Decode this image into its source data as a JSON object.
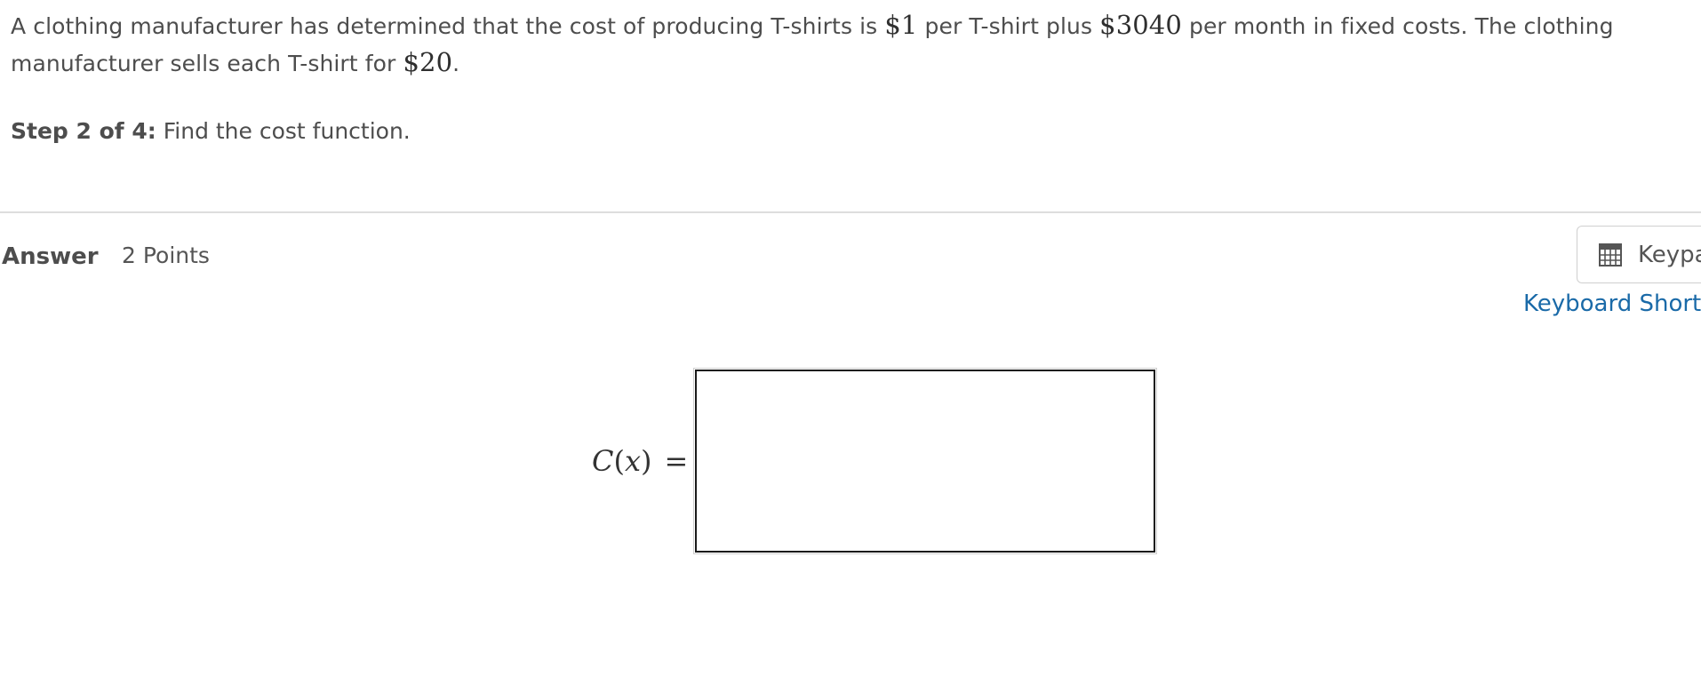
{
  "problem": {
    "text_a": "A clothing manufacturer has determined that the cost of producing T-shirts is ",
    "unit_cost": "$1",
    "text_b": " per T-shirt plus ",
    "fixed_cost": "$3040",
    "text_c": " per month in fixed costs. The clothing manufacturer sells each T-shirt for ",
    "price": "$20",
    "text_d": "."
  },
  "step": {
    "label": "Step 2 of 4:",
    "instruction": " Find the cost function."
  },
  "answer": {
    "label": "Answer",
    "points": "2 Points"
  },
  "toolbar": {
    "keypad_label": "Keypad",
    "keyboard_shortcuts_label": "Keyboard Shortcuts"
  },
  "equation": {
    "func": "C",
    "open_paren": "(",
    "variable": "x",
    "close_paren": ")",
    "equals": "=",
    "input_value": ""
  },
  "colors": {
    "text": "#4d4d4d",
    "link": "#1a6aa8",
    "divider": "#dddddd",
    "input_border": "#1a1a1a"
  },
  "icons": {
    "keypad": "calculator-grid-icon"
  }
}
